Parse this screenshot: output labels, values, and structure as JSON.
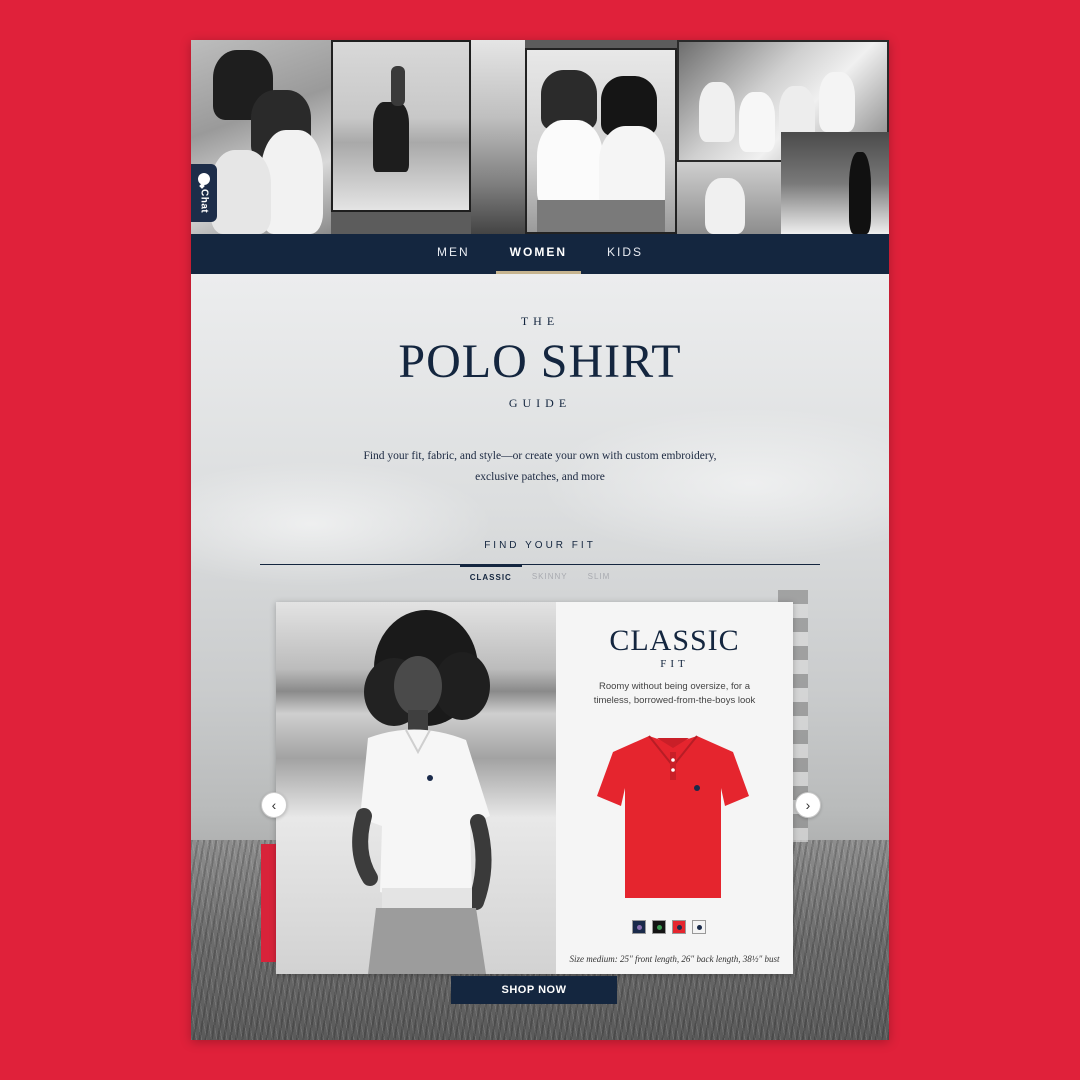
{
  "chat": {
    "label": "Chat",
    "icon": "chat-bubble-icon"
  },
  "nav": {
    "items": [
      {
        "label": "MEN",
        "active": false
      },
      {
        "label": "WOMEN",
        "active": true
      },
      {
        "label": "KIDS",
        "active": false
      }
    ]
  },
  "hero": {
    "kicker": "THE",
    "title": "POLO SHIRT",
    "subtitle": "GUIDE",
    "intro": "Find your fit, fabric, and style—or create your own with custom embroidery, exclusive patches, and more"
  },
  "fit_finder": {
    "heading": "FIND YOUR FIT",
    "tabs": [
      {
        "label": "CLASSIC",
        "active": true
      },
      {
        "label": "SKINNY",
        "active": false
      },
      {
        "label": "SLIM",
        "active": false
      }
    ]
  },
  "card": {
    "title": "CLASSIC",
    "subtitle": "FIT",
    "description": "Roomy without being oversize, for a timeless, borrowed-from-the-boys look",
    "size_note": "Size medium: 25\" front length, 26\" back length, 38½\" bust",
    "shirt_color": "#e5252e",
    "swatches": [
      {
        "color": "#1a2a4a",
        "logo": "#8a6fb0"
      },
      {
        "color": "#141414",
        "logo": "#3a9a50"
      },
      {
        "color": "#e5252e",
        "logo": "#1a2a4a"
      },
      {
        "color": "#f4f4f4",
        "logo": "#1a2a4a"
      }
    ]
  },
  "carousel": {
    "prev_icon": "chevron-left-icon",
    "next_icon": "chevron-right-icon",
    "prev_glyph": "‹",
    "next_glyph": "›"
  },
  "cta": {
    "label": "SHOP NOW"
  },
  "colors": {
    "background": "#e0213a",
    "navy": "#14263f",
    "accent_gold": "#c6b48f"
  }
}
